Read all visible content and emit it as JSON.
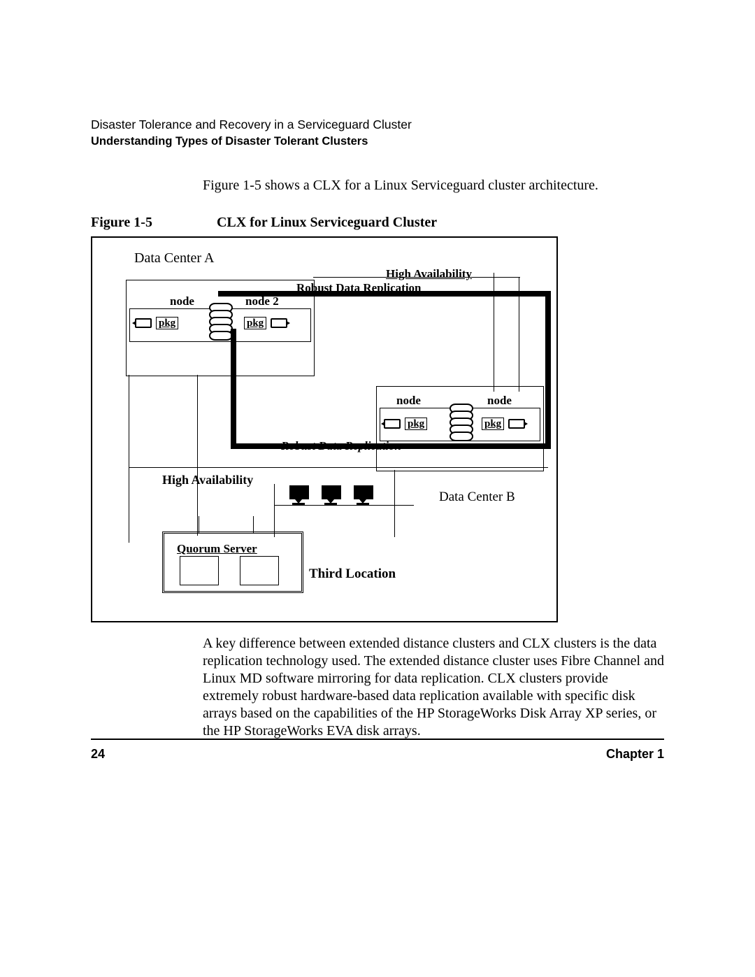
{
  "header": {
    "line1": "Disaster Tolerance and Recovery in a Serviceguard Cluster",
    "line2": "Understanding Types of Disaster Tolerant Clusters"
  },
  "intro": "Figure 1-5 shows a CLX for a Linux Serviceguard cluster architecture.",
  "figure": {
    "number": "Figure 1-5",
    "title": "CLX for Linux Serviceguard Cluster"
  },
  "diagram": {
    "dcA": "Data Center A",
    "dcB": "Data Center B",
    "ha": "High Availability",
    "rdr": "Robust Data Replication",
    "node_label": "node",
    "node2_label": "node 2",
    "pkg_a": "pkg",
    "pkg_b": "pkg",
    "quorum": "Quorum Server",
    "third": "Third Location"
  },
  "paragraph": "A key difference between extended distance clusters and CLX clusters is the data replication technology used. The extended distance cluster uses Fibre Channel and Linux MD software mirroring for data replication. CLX clusters provide extremely robust hardware-based data replication available with specific disk arrays based on the capabilities of the HP StorageWorks Disk Array XP series, or the HP StorageWorks EVA disk arrays.",
  "footer": {
    "page": "24",
    "chapter": "Chapter 1"
  }
}
